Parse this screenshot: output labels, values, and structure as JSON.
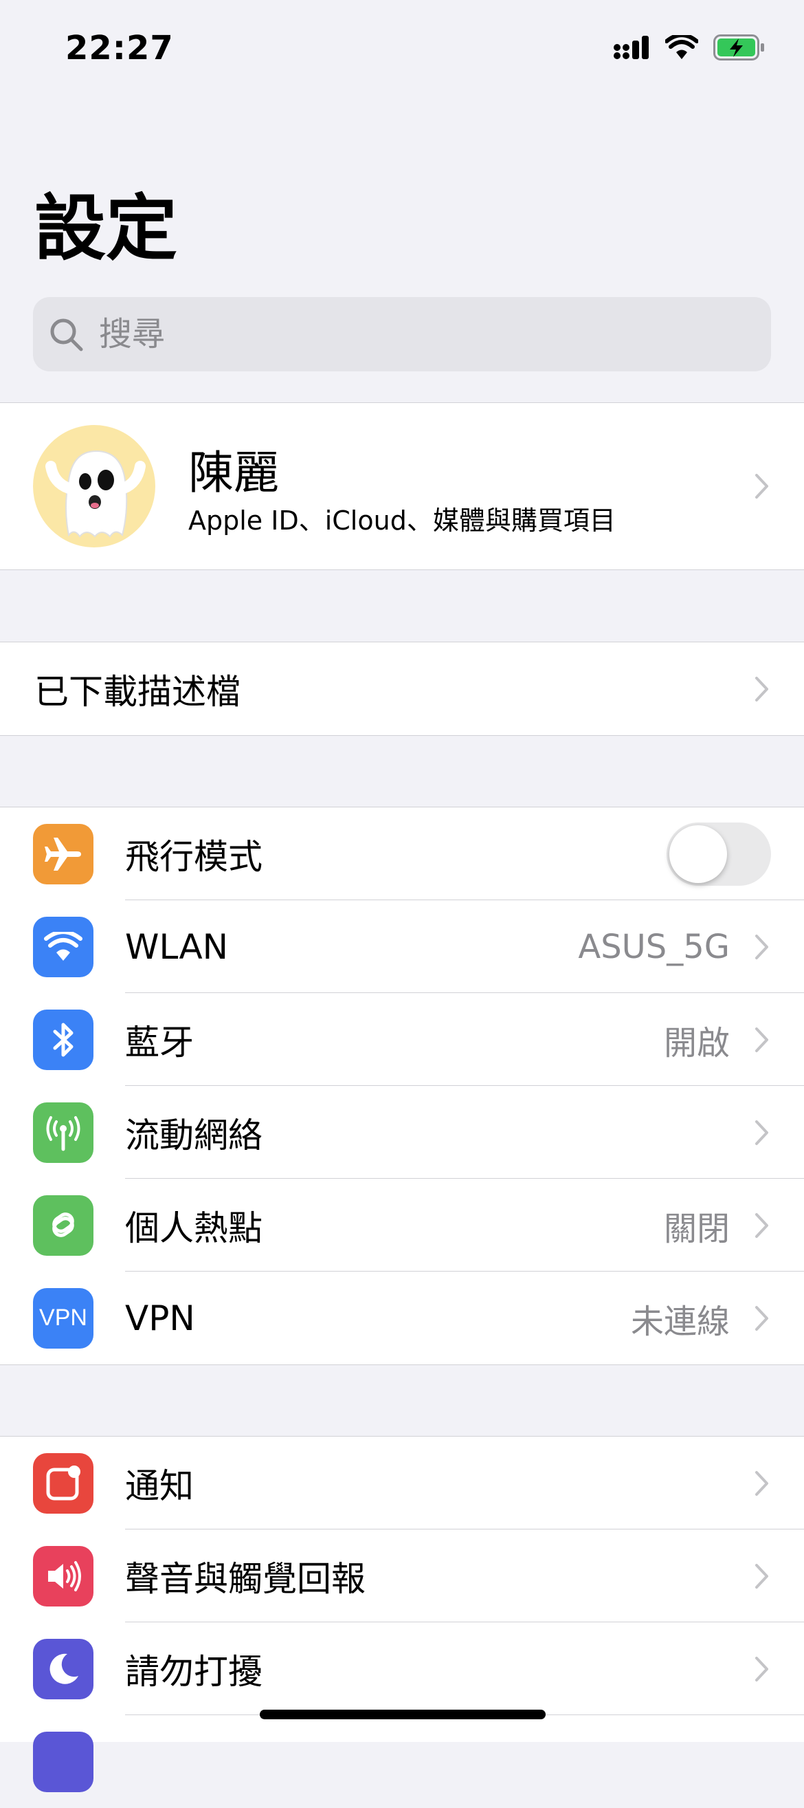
{
  "status": {
    "time": "22:27"
  },
  "title": "設定",
  "search": {
    "placeholder": "搜尋"
  },
  "profile": {
    "name": "陳麗",
    "subtitle": "Apple ID、iCloud、媒體與購買項目"
  },
  "profiles_row": {
    "label": "已下載描述檔"
  },
  "connectivity": [
    {
      "label": "飛行模式",
      "icon": "airplane-icon",
      "color": "#f19a37",
      "toggle": false
    },
    {
      "label": "WLAN",
      "value": "ASUS_5G",
      "icon": "wifi-icon",
      "color": "#3b82f6"
    },
    {
      "label": "藍牙",
      "value": "開啟",
      "icon": "bluetooth-icon",
      "color": "#3b82f6"
    },
    {
      "label": "流動網絡",
      "value": "",
      "icon": "antenna-icon",
      "color": "#5ec05e"
    },
    {
      "label": "個人熱點",
      "value": "關閉",
      "icon": "hotspot-icon",
      "color": "#5ec05e"
    },
    {
      "label": "VPN",
      "value": "未連線",
      "icon": "vpn-icon",
      "icon_text": "VPN",
      "color": "#3b82f6"
    }
  ],
  "system": [
    {
      "label": "通知",
      "icon": "notifications-icon",
      "color": "#e8463d"
    },
    {
      "label": "聲音與觸覺回報",
      "icon": "sound-icon",
      "color": "#e8415c"
    },
    {
      "label": "請勿打擾",
      "icon": "moon-icon",
      "color": "#5a56d6"
    }
  ]
}
